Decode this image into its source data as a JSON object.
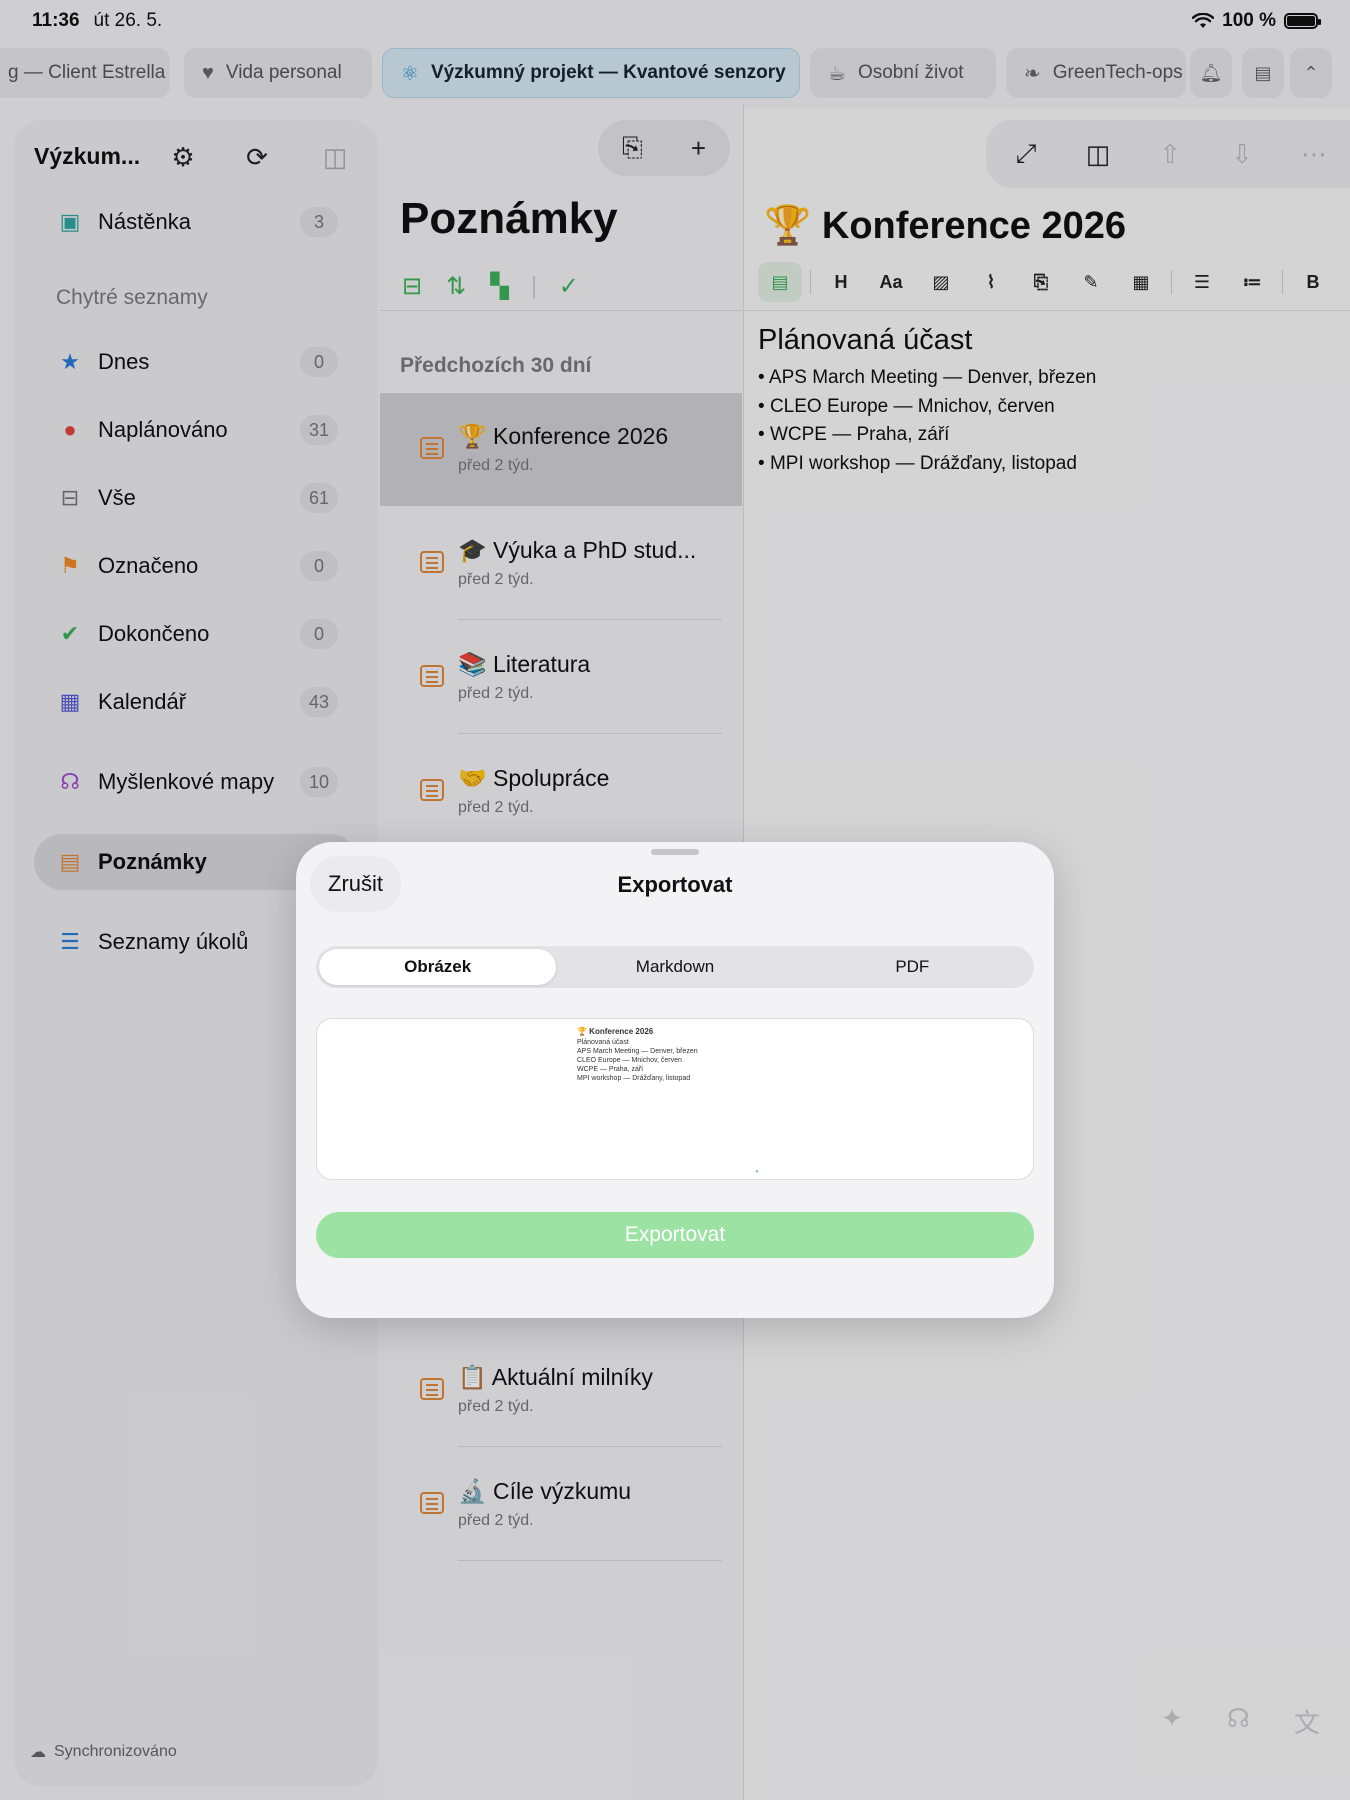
{
  "status": {
    "time": "11:36",
    "date": "út 26. 5.",
    "battery": "100 %"
  },
  "tabs": [
    {
      "label": "g — Client Estrella",
      "icon": ""
    },
    {
      "label": "Vida personal",
      "icon": "heart-icon"
    },
    {
      "label": "Výzkumný projekt — Kvantové senzory",
      "icon": "atom-icon",
      "active": true
    },
    {
      "label": "Osobní život",
      "icon": "cup-icon"
    },
    {
      "label": "GreenTech-ops",
      "icon": "leaf-icon"
    }
  ],
  "sidebar": {
    "title": "Výzkum...",
    "smart_lists_label": "Chytré seznamy",
    "items": [
      {
        "label": "Nástěnka",
        "count": "3"
      },
      {
        "label": "Dnes",
        "count": "0"
      },
      {
        "label": "Naplánováno",
        "count": "31"
      },
      {
        "label": "Vše",
        "count": "61"
      },
      {
        "label": "Označeno",
        "count": "0"
      },
      {
        "label": "Dokončeno",
        "count": "0"
      },
      {
        "label": "Kalendář",
        "count": "43"
      },
      {
        "label": "Myšlenkové mapy",
        "count": "10"
      },
      {
        "label": "Poznámky"
      },
      {
        "label": "Seznamy úkolů"
      }
    ],
    "footer": "Synchronizováno"
  },
  "notes_list": {
    "title": "Poznámky",
    "section": "Předchozích 30 dní",
    "notes": [
      {
        "title": "🏆 Konference 2026",
        "subtitle": "před 2 týd."
      },
      {
        "title": "🎓 Výuka a PhD stud...",
        "subtitle": "před 2 týd."
      },
      {
        "title": "📚 Literatura",
        "subtitle": "před 2 týd."
      },
      {
        "title": "🤝 Spolupráce",
        "subtitle": "před 2 týd."
      },
      {
        "title": "📋 Aktuální milníky",
        "subtitle": "před 2 týd."
      },
      {
        "title": "🔬 Cíle výzkumu",
        "subtitle": "před 2 týd."
      }
    ]
  },
  "editor": {
    "title": "🏆 Konference 2026",
    "heading": "Plánovaná účast",
    "items": [
      "APS March Meeting — Denver, březen",
      "CLEO Europe — Mnichov, červen",
      "WCPE — Praha, září",
      "MPI workshop — Drážďany, listopad"
    ],
    "toolbar": {
      "h": "H",
      "aa": "Aa",
      "bold": "B"
    }
  },
  "export_modal": {
    "cancel": "Zrušit",
    "title": "Exportovat",
    "formats": [
      "Obrázek",
      "Markdown",
      "PDF"
    ],
    "selected_format": "Obrázek",
    "preview_title": "🏆 Konference 2026",
    "export_button": "Exportovat",
    "colors": {
      "accent": "#3cb05a",
      "export_button": "#9ce2a2"
    }
  }
}
